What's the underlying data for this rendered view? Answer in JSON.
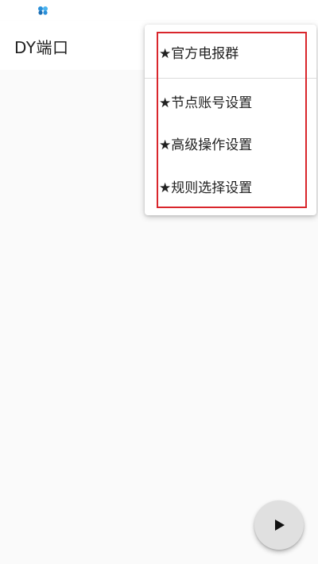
{
  "status_bar": {
    "notification_icon": "app-notification-icon"
  },
  "app_bar": {
    "title": "DY端口"
  },
  "menu": {
    "items": [
      {
        "label": "★官方电报群"
      },
      {
        "label": "★节点账号设置"
      },
      {
        "label": "★高级操作设置"
      },
      {
        "label": "★规则选择设置"
      }
    ],
    "highlight_color": "#d9262c"
  },
  "fab": {
    "icon": "play-icon",
    "background": "#e0e0e0"
  }
}
